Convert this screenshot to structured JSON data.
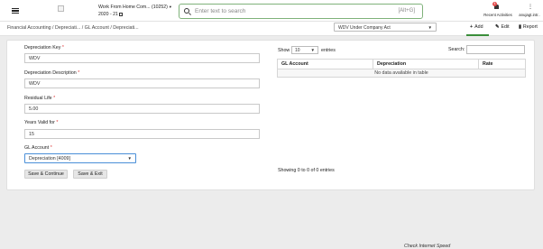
{
  "header": {
    "company": "Work From Home Com... (10252)",
    "year": "2020 - 21",
    "search": {
      "placeholder": "Enter text to search",
      "shortcut": "[Alt+G]"
    },
    "recent": {
      "label": "Recent Activities",
      "count": "4"
    },
    "user": {
      "label": "anujagt.intr.."
    }
  },
  "subheader": {
    "breadcrumb": "Financial Accounting  / Depreciati... / GL Account / Depreciati...",
    "act_select": "WDV Under Company Act",
    "actions": {
      "add": "Add",
      "edit": "Edit",
      "report": "Report"
    }
  },
  "form": {
    "depreciation_key": {
      "label": "Depreciation Key",
      "value": "WDV"
    },
    "depreciation_description": {
      "label": "Depreciation Description",
      "value": "WDV"
    },
    "residual_life": {
      "label": "Residual Life",
      "value": "5.00"
    },
    "years_valid_for": {
      "label": "Years Valid for",
      "value": "15"
    },
    "gl_account": {
      "label": "GL Account",
      "value": "Depreciation [4009]"
    },
    "required_mark": "*",
    "buttons": {
      "save_continue": "Save & Continue",
      "save_exit": "Save & Exit"
    }
  },
  "table": {
    "show_label": "Show",
    "page_length": "10",
    "entries_label": "entries",
    "search_label": "Search:",
    "columns": [
      "GL Account",
      "Depreciation",
      "Rate"
    ],
    "empty_message": "No data available in table",
    "info": "Showing 0 to 0 of 0 entries"
  },
  "footer": {
    "speed": "Check Internet Speed"
  },
  "colors": {
    "accent_green": "#3a8d3a",
    "focus_blue": "#4a8fd8",
    "badge_red": "#e34b4b"
  }
}
